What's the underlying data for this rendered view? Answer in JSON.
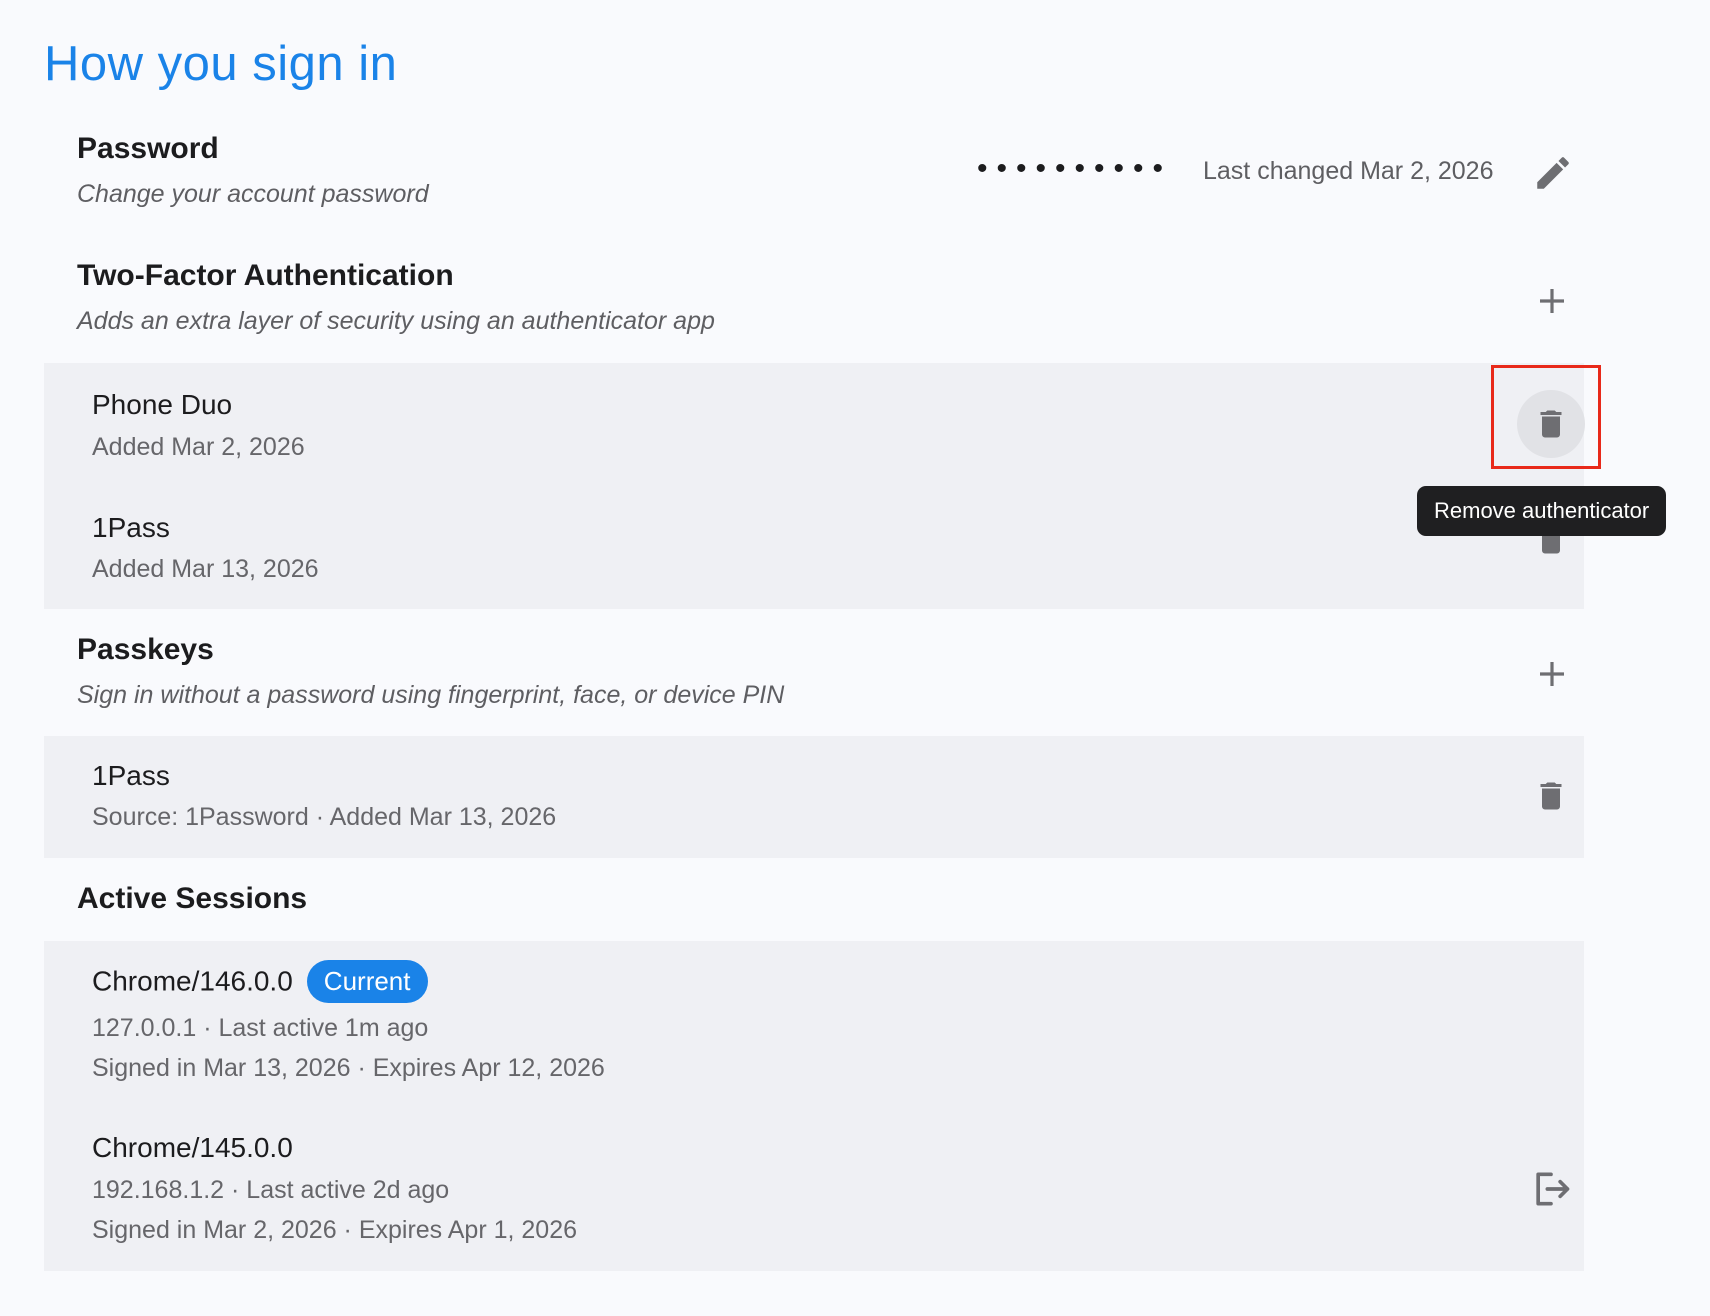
{
  "page_title": "How you sign in",
  "password": {
    "title": "Password",
    "description": "Change your account password",
    "masked": "••••••••••",
    "last_changed": "Last changed Mar 2, 2026"
  },
  "two_factor": {
    "title": "Two-Factor Authentication",
    "description": "Adds an extra layer of security using an authenticator app",
    "items": [
      {
        "name": "Phone Duo",
        "added": "Added Mar 2, 2026"
      },
      {
        "name": "1Pass",
        "added": "Added Mar 13, 2026"
      }
    ],
    "tooltip": "Remove authenticator"
  },
  "passkeys": {
    "title": "Passkeys",
    "description": "Sign in without a password using fingerprint, face, or device PIN",
    "items": [
      {
        "name": "1Pass",
        "details": "Source: 1Password · Added Mar 13, 2026"
      }
    ]
  },
  "sessions": {
    "title": "Active Sessions",
    "items": [
      {
        "browser": "Chrome/146.0.0",
        "badge": "Current",
        "activity": "127.0.0.1 · Last active 1m ago",
        "signed": "Signed in Mar 13, 2026 · Expires Apr 12, 2026"
      },
      {
        "browser": "Chrome/145.0.0",
        "activity": "192.168.1.2 · Last active 2d ago",
        "signed": "Signed in Mar 2, 2026 · Expires Apr 1, 2026"
      }
    ]
  },
  "icons": {
    "edit": "pencil-icon",
    "add": "plus-icon",
    "delete": "trash-icon",
    "logout": "logout-icon"
  },
  "colors": {
    "accent": "#1a83e8",
    "background": "#f9fafd",
    "panel": "#eff0f4",
    "icon": "#6e6e72",
    "highlight": "#e8291a"
  }
}
